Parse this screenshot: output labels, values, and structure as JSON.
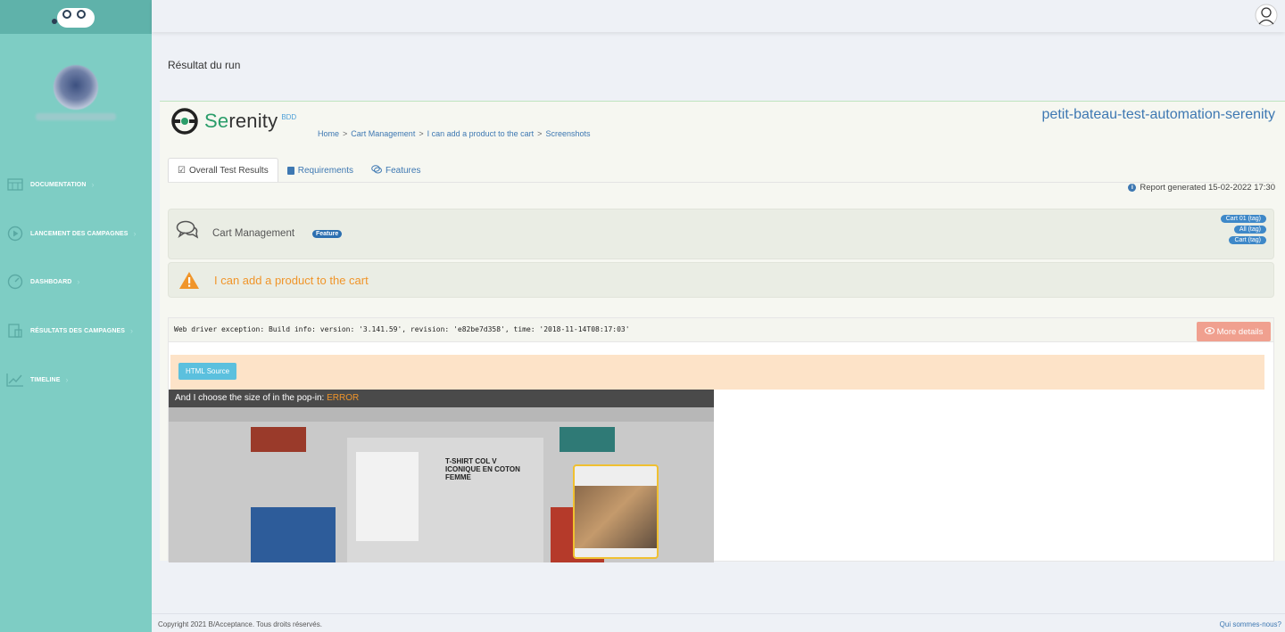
{
  "app": {
    "page_title": "Résultat du run",
    "footer_copyright": "Copyright 2021 B/Acceptance. Tous droits réservés.",
    "footer_link": "Qui sommes-nous?"
  },
  "sidebar": {
    "items": [
      {
        "label": "DOCUMENTATION",
        "icon": "calendar-grid-icon"
      },
      {
        "label": "LANCEMENT DES CAMPAGNES",
        "icon": "play-circle-icon"
      },
      {
        "label": "DASHBOARD",
        "icon": "gauge-icon"
      },
      {
        "label": "RÉSULTATS DES CAMPAGNES",
        "icon": "report-icon"
      },
      {
        "label": "TIMELINE",
        "icon": "line-chart-icon"
      }
    ]
  },
  "report": {
    "logo_text_a": "Se",
    "logo_text_b": "renity",
    "logo_suffix": "BDD",
    "project_name": "petit-bateau-test-automation-serenity",
    "breadcrumb": [
      "Home",
      "Cart Management",
      "I can add a product to the cart",
      "Screenshots"
    ],
    "tabs": [
      {
        "label": "Overall Test Results",
        "icon": "check-square-icon",
        "active": true
      },
      {
        "label": "Requirements",
        "icon": "book-icon",
        "active": false
      },
      {
        "label": "Features",
        "icon": "comments-icon",
        "active": false
      }
    ],
    "report_generated": "Report generated 15-02-2022 17:30",
    "feature": {
      "name": "Cart Management",
      "badge": "Feature",
      "tags": [
        "Cart 01 (tag)",
        "All (tag)",
        "Cart (tag)"
      ]
    },
    "scenario": {
      "title": "I can add a product to the cart",
      "status": "warning"
    },
    "error": {
      "message": "Web driver exception: Build info: version: '3.141.59', revision: 'e82be7d358', time: '2018-11-14T08:17:03'",
      "more_details": "More details",
      "html_source": "HTML Source"
    },
    "screenshot": {
      "caption": "And I choose the size of in the pop-in: ",
      "caption_status": "ERROR",
      "product_title": "T-SHIRT COL V ICONIQUE EN COTON FEMME"
    }
  },
  "colors": {
    "sidebar": "#7ecdc4",
    "link": "#3e78b2",
    "warning": "#f0952a",
    "more_details_bg": "#f0a08f"
  }
}
